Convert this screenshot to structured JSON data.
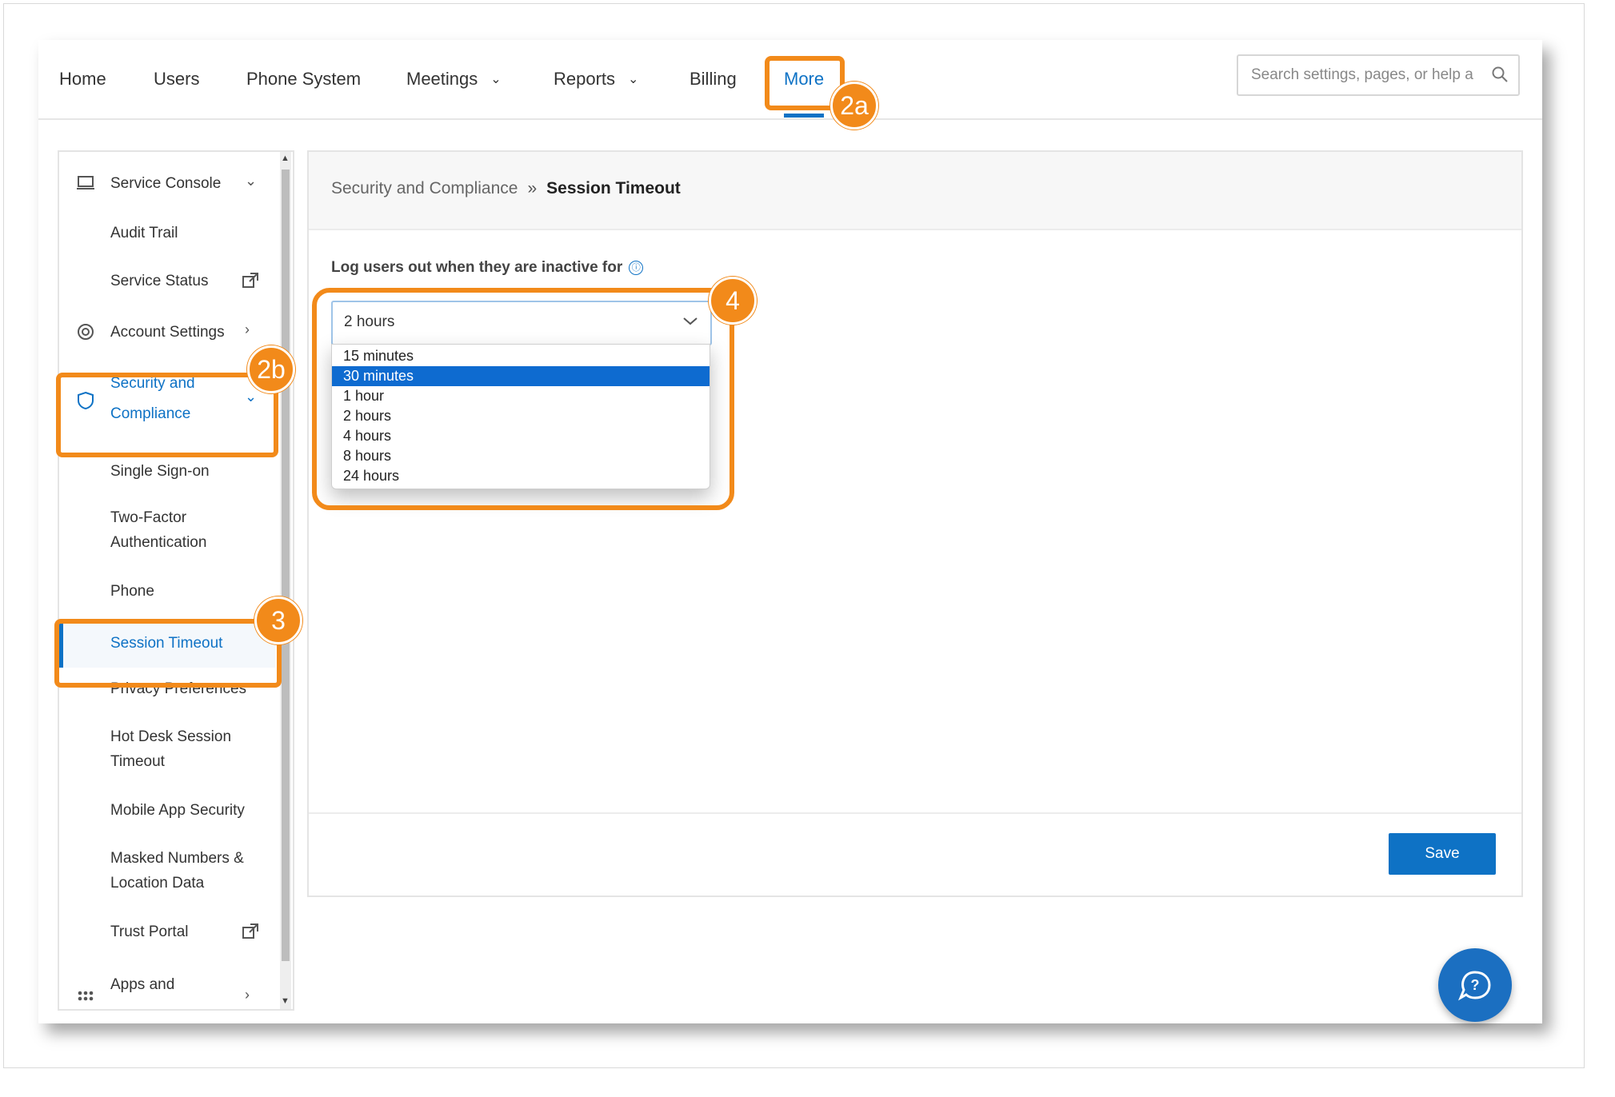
{
  "nav": {
    "items": [
      {
        "label": "Home",
        "has_dropdown": false
      },
      {
        "label": "Users",
        "has_dropdown": false
      },
      {
        "label": "Phone System",
        "has_dropdown": false
      },
      {
        "label": "Meetings",
        "has_dropdown": true
      },
      {
        "label": "Reports",
        "has_dropdown": true
      },
      {
        "label": "Billing",
        "has_dropdown": false
      },
      {
        "label": "More",
        "has_dropdown": false,
        "active": true
      }
    ],
    "search_placeholder": "Search settings, pages, or help a"
  },
  "sidebar": {
    "items": [
      {
        "label": "Service Console",
        "icon": "laptop-icon",
        "arrow": "chevron-down"
      },
      {
        "label": "Audit Trail"
      },
      {
        "label": "Service Status",
        "trailing_icon": "external-link-icon"
      },
      {
        "label": "Account Settings",
        "icon": "gear-icon",
        "arrow": "chevron-right"
      },
      {
        "label": "Security and Compliance",
        "label_line1": "Security and",
        "label_line2": "Compliance",
        "icon": "shield-icon",
        "arrow": "chevron-down",
        "expanded": true
      },
      {
        "label": "Single Sign-on"
      },
      {
        "label": "Two-Factor Authentication",
        "label_line1": "Two-Factor",
        "label_line2": "Authentication"
      },
      {
        "label": "Phone"
      },
      {
        "label": "Session Timeout",
        "selected": true
      },
      {
        "label": "Privacy Preferences"
      },
      {
        "label": "Hot Desk Session Timeout",
        "label_line1": "Hot Desk Session",
        "label_line2": "Timeout"
      },
      {
        "label": "Mobile App Security"
      },
      {
        "label": "Masked Numbers & Location Data",
        "label_line1": "Masked Numbers &",
        "label_line2": "Location Data"
      },
      {
        "label": "Trust Portal",
        "trailing_icon": "external-link-icon"
      },
      {
        "label": "Apps and",
        "icon": "apps-grid-icon",
        "arrow": "chevron-right"
      }
    ]
  },
  "breadcrumb": {
    "parent": "Security and Compliance",
    "separator": "»",
    "current": "Session Timeout"
  },
  "form": {
    "label": "Log users out when they are inactive for",
    "info_icon": "ⓘ",
    "selected_value": "2 hours",
    "options": [
      "15 minutes",
      "30 minutes",
      "1 hour",
      "2 hours",
      "4 hours",
      "8 hours",
      "24 hours"
    ],
    "highlighted_option": "30 minutes"
  },
  "save_label": "Save",
  "callouts": {
    "more_tab": "2a",
    "security_group": "2b",
    "session_timeout": "3",
    "dropdown": "4"
  },
  "colors": {
    "accent": "#0e72c5",
    "callout": "#f28a1a",
    "highlight": "#0e6bd0"
  }
}
